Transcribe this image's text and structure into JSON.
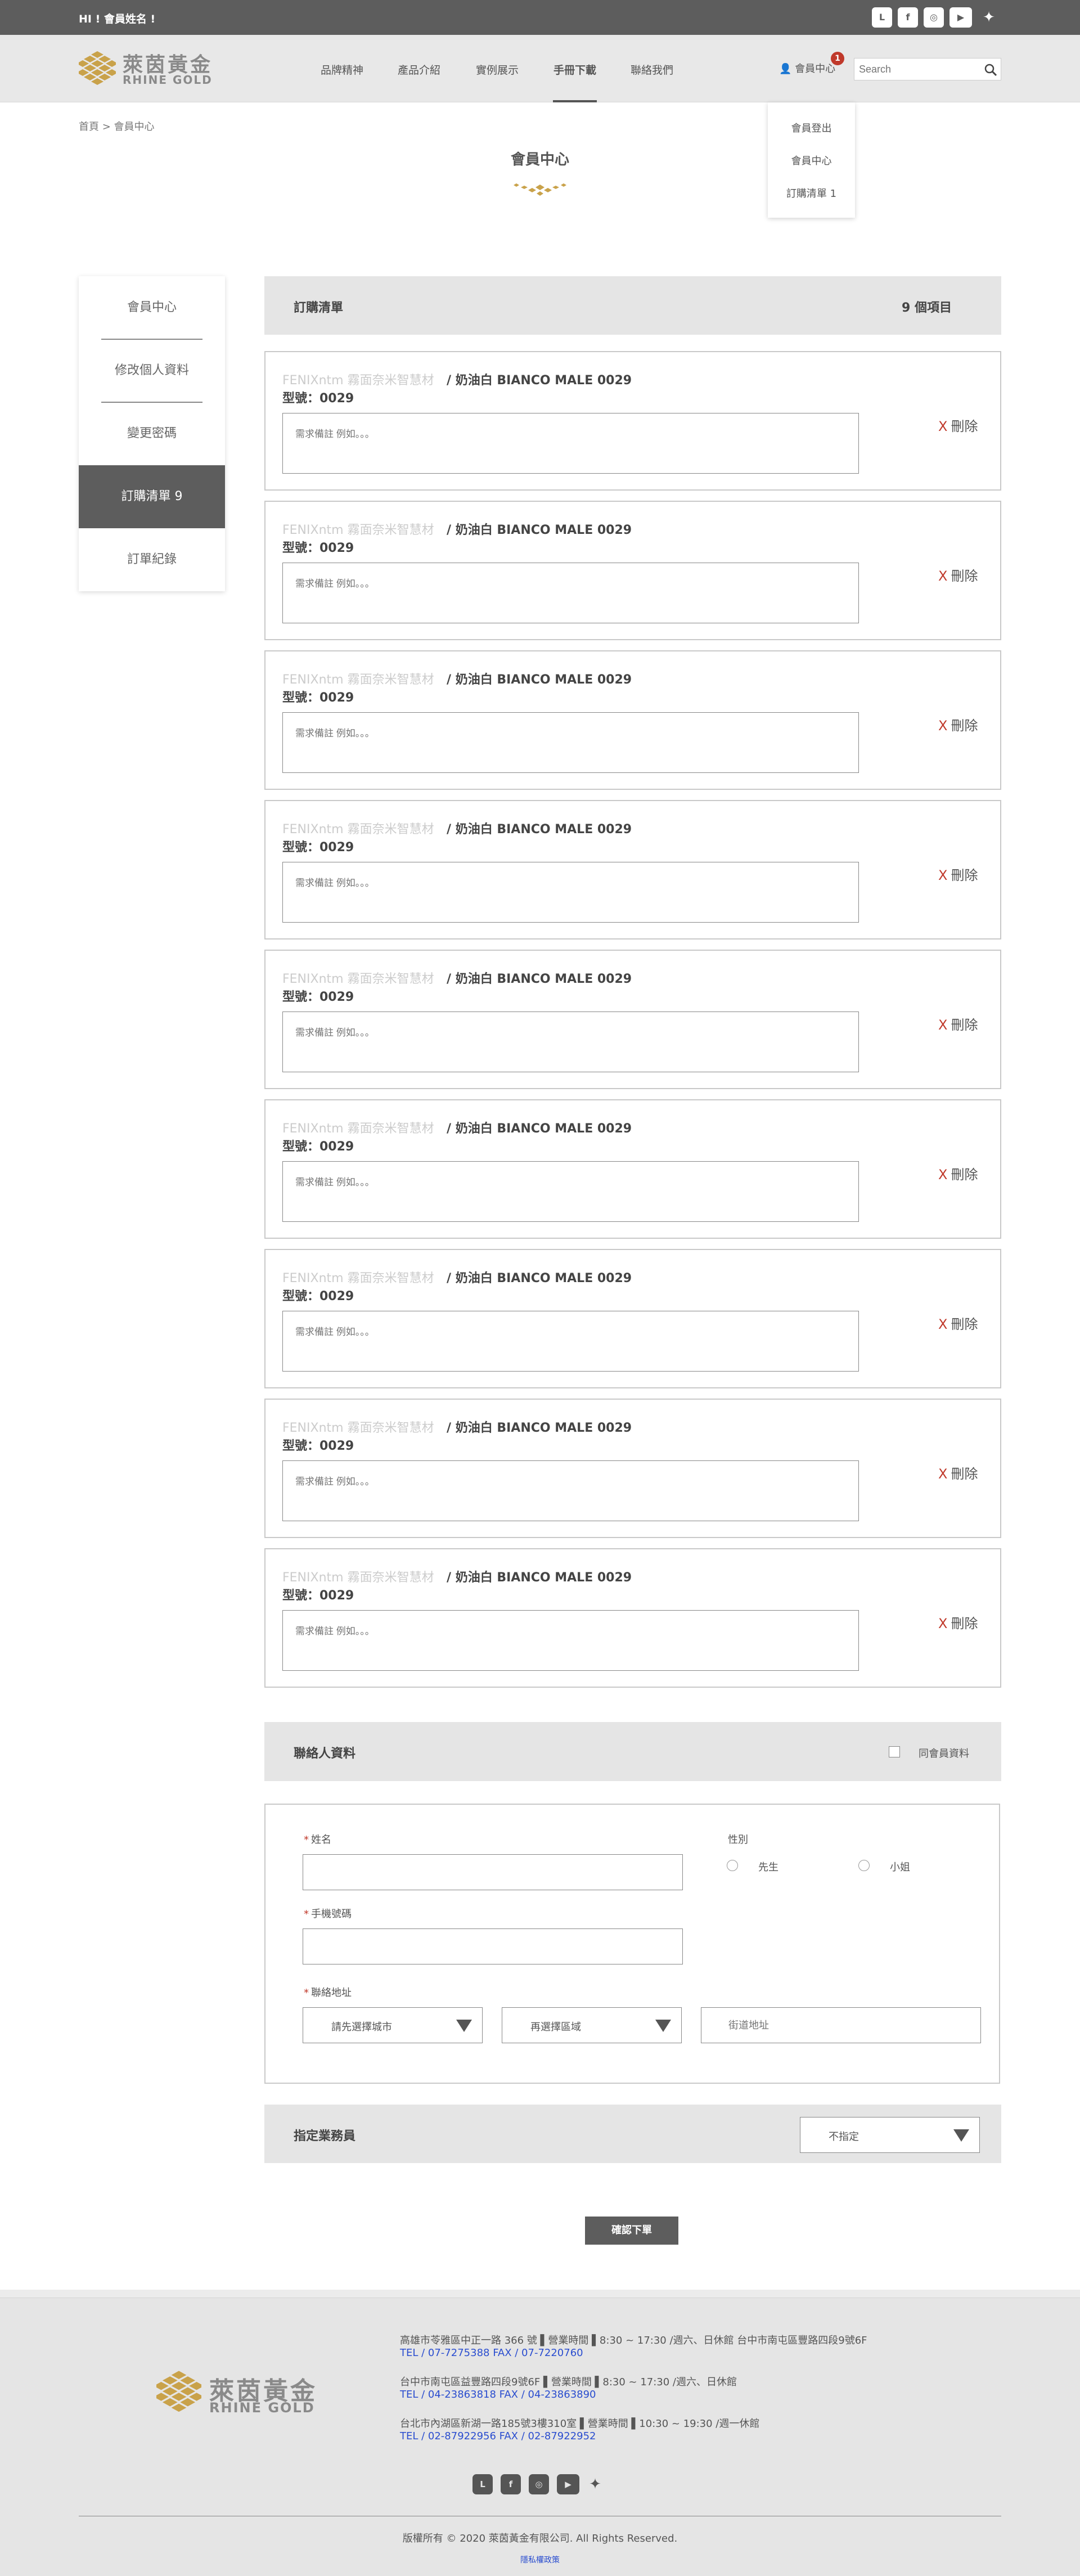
{
  "topbar": {
    "greeting": "HI ! 會員姓名 !",
    "social": [
      "line-icon",
      "facebook-icon",
      "instagram-icon",
      "youtube-icon",
      "twitter-icon"
    ]
  },
  "brand": {
    "name_cn": "萊茵黃金",
    "name_en": "RHINE GOLD",
    "gold": "#c9a24a"
  },
  "nav": {
    "items": [
      "品牌精神",
      "產品介紹",
      "實例展示",
      "手冊下載",
      "聯絡我們"
    ],
    "active": "手冊下載"
  },
  "member": {
    "label": "會員中心",
    "badge": "1"
  },
  "search": {
    "placeholder": "Search"
  },
  "dropdown": {
    "items": [
      "會員登出",
      "會員中心",
      "訂購清單 1"
    ]
  },
  "breadcrumb": "首頁 > 會員中心",
  "page_title": "會員中心",
  "sidebar": {
    "items": [
      "會員中心",
      "修改個人資料",
      "變更密碼",
      "訂購清單 9",
      "訂單紀錄"
    ],
    "active": "訂購清單 9"
  },
  "order": {
    "title": "訂購清單",
    "count": "9 個項目",
    "items": [
      {
        "category": "FENIXntm 霧面奈米智慧材",
        "name": "/ 奶油白 BIANCO MALE 0029",
        "model": "型號：0029",
        "note_placeholder": "需求備註 例如。。。",
        "delete": "刪除"
      },
      {
        "category": "FENIXntm 霧面奈米智慧材",
        "name": "/ 奶油白 BIANCO MALE 0029",
        "model": "型號：0029",
        "note_placeholder": "需求備註 例如。。。",
        "delete": "刪除"
      },
      {
        "category": "FENIXntm 霧面奈米智慧材",
        "name": "/ 奶油白 BIANCO MALE 0029",
        "model": "型號：0029",
        "note_placeholder": "需求備註 例如。。。",
        "delete": "刪除"
      },
      {
        "category": "FENIXntm 霧面奈米智慧材",
        "name": "/ 奶油白 BIANCO MALE 0029",
        "model": "型號：0029",
        "note_placeholder": "需求備註 例如。。。",
        "delete": "刪除"
      },
      {
        "category": "FENIXntm 霧面奈米智慧材",
        "name": "/ 奶油白 BIANCO MALE 0029",
        "model": "型號：0029",
        "note_placeholder": "需求備註 例如。。。",
        "delete": "刪除"
      },
      {
        "category": "FENIXntm 霧面奈米智慧材",
        "name": "/ 奶油白 BIANCO MALE 0029",
        "model": "型號：0029",
        "note_placeholder": "需求備註 例如。。。",
        "delete": "刪除"
      },
      {
        "category": "FENIXntm 霧面奈米智慧材",
        "name": "/ 奶油白 BIANCO MALE 0029",
        "model": "型號：0029",
        "note_placeholder": "需求備註 例如。。。",
        "delete": "刪除"
      },
      {
        "category": "FENIXntm 霧面奈米智慧材",
        "name": "/ 奶油白 BIANCO MALE 0029",
        "model": "型號：0029",
        "note_placeholder": "需求備註 例如。。。",
        "delete": "刪除"
      },
      {
        "category": "FENIXntm 霧面奈米智慧材",
        "name": "/ 奶油白 BIANCO MALE 0029",
        "model": "型號：0029",
        "note_placeholder": "需求備註 例如。。。",
        "delete": "刪除"
      }
    ]
  },
  "contact": {
    "title": "聯絡人資料",
    "same_as_member": "同會員資料",
    "name_label": "姓名",
    "gender_label": "性別",
    "gender_options": [
      "先生",
      "小姐"
    ],
    "phone_label": "手機號碼",
    "address_label": "聯絡地址",
    "city_placeholder": "請先選擇城市",
    "district_placeholder": "再選擇區域",
    "street_placeholder": "街道地址"
  },
  "sales": {
    "title": "指定業務員",
    "selected": "不指定"
  },
  "confirm_label": "確認下單",
  "footer": {
    "branches": [
      {
        "address": "高雄市苓雅區中正一路 366 號 ▌營業時間 ▌8:30 ~ 17:30 /週六、日休館 台中市南屯區豐路四段9號6F",
        "tel": "TEL / 07-7275388     FAX / 07-7220760"
      },
      {
        "address": "台中市南屯區益豐路四段9號6F ▌營業時間 ▌8:30 ~ 17:30 /週六、日休館",
        "tel": "TEL / 04-23863818     FAX / 04-23863890"
      },
      {
        "address": "台北市內湖區新湖一路185號3樓310室 ▌營業時間 ▌10:30 ~ 19:30 /週一休館",
        "tel": "TEL / 02-87922956     FAX / 02-87922952"
      }
    ],
    "copyright": "版權所有 © 2020   萊茵黃金有限公司.    All Rights Reserved.",
    "privacy": "隱私權政策"
  }
}
